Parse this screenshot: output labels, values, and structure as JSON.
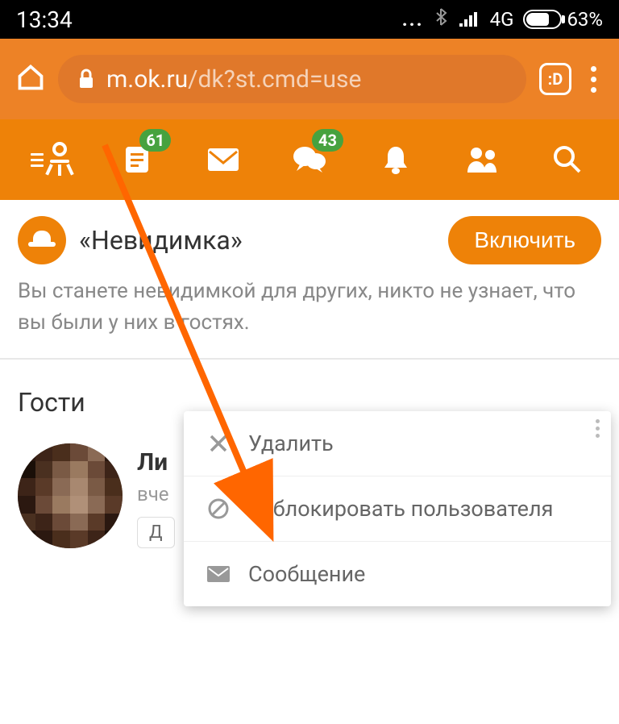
{
  "statusbar": {
    "time": "13:34",
    "network": "4G",
    "battery": "63%"
  },
  "browser": {
    "url_domain": "m.ok.ru",
    "url_path": "/dk?st.cmd=use",
    "tab_indicator": ":D"
  },
  "nav": {
    "feed_badge": "61",
    "discussions_badge": "43"
  },
  "promo": {
    "title": "«Невидимка»",
    "button": "Включить",
    "description": "Вы станете невидимкой для других, никто не узнает, что вы были у них в гостях."
  },
  "section": {
    "guests_title": "Гости"
  },
  "guest": {
    "name_partial": "Ли",
    "time_partial": "вче",
    "action_partial": "Д"
  },
  "popup": {
    "delete": "Удалить",
    "block": "Заблокировать пользователя",
    "message": "Сообщение"
  }
}
